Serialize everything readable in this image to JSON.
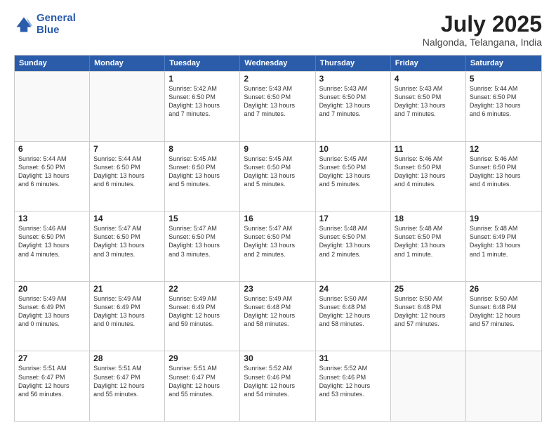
{
  "logo": {
    "text_general": "General",
    "text_blue": "Blue"
  },
  "title": "July 2025",
  "location": "Nalgonda, Telangana, India",
  "weekdays": [
    "Sunday",
    "Monday",
    "Tuesday",
    "Wednesday",
    "Thursday",
    "Friday",
    "Saturday"
  ],
  "rows": [
    [
      {
        "day": "",
        "lines": []
      },
      {
        "day": "",
        "lines": []
      },
      {
        "day": "1",
        "lines": [
          "Sunrise: 5:42 AM",
          "Sunset: 6:50 PM",
          "Daylight: 13 hours",
          "and 7 minutes."
        ]
      },
      {
        "day": "2",
        "lines": [
          "Sunrise: 5:43 AM",
          "Sunset: 6:50 PM",
          "Daylight: 13 hours",
          "and 7 minutes."
        ]
      },
      {
        "day": "3",
        "lines": [
          "Sunrise: 5:43 AM",
          "Sunset: 6:50 PM",
          "Daylight: 13 hours",
          "and 7 minutes."
        ]
      },
      {
        "day": "4",
        "lines": [
          "Sunrise: 5:43 AM",
          "Sunset: 6:50 PM",
          "Daylight: 13 hours",
          "and 7 minutes."
        ]
      },
      {
        "day": "5",
        "lines": [
          "Sunrise: 5:44 AM",
          "Sunset: 6:50 PM",
          "Daylight: 13 hours",
          "and 6 minutes."
        ]
      }
    ],
    [
      {
        "day": "6",
        "lines": [
          "Sunrise: 5:44 AM",
          "Sunset: 6:50 PM",
          "Daylight: 13 hours",
          "and 6 minutes."
        ]
      },
      {
        "day": "7",
        "lines": [
          "Sunrise: 5:44 AM",
          "Sunset: 6:50 PM",
          "Daylight: 13 hours",
          "and 6 minutes."
        ]
      },
      {
        "day": "8",
        "lines": [
          "Sunrise: 5:45 AM",
          "Sunset: 6:50 PM",
          "Daylight: 13 hours",
          "and 5 minutes."
        ]
      },
      {
        "day": "9",
        "lines": [
          "Sunrise: 5:45 AM",
          "Sunset: 6:50 PM",
          "Daylight: 13 hours",
          "and 5 minutes."
        ]
      },
      {
        "day": "10",
        "lines": [
          "Sunrise: 5:45 AM",
          "Sunset: 6:50 PM",
          "Daylight: 13 hours",
          "and 5 minutes."
        ]
      },
      {
        "day": "11",
        "lines": [
          "Sunrise: 5:46 AM",
          "Sunset: 6:50 PM",
          "Daylight: 13 hours",
          "and 4 minutes."
        ]
      },
      {
        "day": "12",
        "lines": [
          "Sunrise: 5:46 AM",
          "Sunset: 6:50 PM",
          "Daylight: 13 hours",
          "and 4 minutes."
        ]
      }
    ],
    [
      {
        "day": "13",
        "lines": [
          "Sunrise: 5:46 AM",
          "Sunset: 6:50 PM",
          "Daylight: 13 hours",
          "and 4 minutes."
        ]
      },
      {
        "day": "14",
        "lines": [
          "Sunrise: 5:47 AM",
          "Sunset: 6:50 PM",
          "Daylight: 13 hours",
          "and 3 minutes."
        ]
      },
      {
        "day": "15",
        "lines": [
          "Sunrise: 5:47 AM",
          "Sunset: 6:50 PM",
          "Daylight: 13 hours",
          "and 3 minutes."
        ]
      },
      {
        "day": "16",
        "lines": [
          "Sunrise: 5:47 AM",
          "Sunset: 6:50 PM",
          "Daylight: 13 hours",
          "and 2 minutes."
        ]
      },
      {
        "day": "17",
        "lines": [
          "Sunrise: 5:48 AM",
          "Sunset: 6:50 PM",
          "Daylight: 13 hours",
          "and 2 minutes."
        ]
      },
      {
        "day": "18",
        "lines": [
          "Sunrise: 5:48 AM",
          "Sunset: 6:50 PM",
          "Daylight: 13 hours",
          "and 1 minute."
        ]
      },
      {
        "day": "19",
        "lines": [
          "Sunrise: 5:48 AM",
          "Sunset: 6:49 PM",
          "Daylight: 13 hours",
          "and 1 minute."
        ]
      }
    ],
    [
      {
        "day": "20",
        "lines": [
          "Sunrise: 5:49 AM",
          "Sunset: 6:49 PM",
          "Daylight: 13 hours",
          "and 0 minutes."
        ]
      },
      {
        "day": "21",
        "lines": [
          "Sunrise: 5:49 AM",
          "Sunset: 6:49 PM",
          "Daylight: 13 hours",
          "and 0 minutes."
        ]
      },
      {
        "day": "22",
        "lines": [
          "Sunrise: 5:49 AM",
          "Sunset: 6:49 PM",
          "Daylight: 12 hours",
          "and 59 minutes."
        ]
      },
      {
        "day": "23",
        "lines": [
          "Sunrise: 5:49 AM",
          "Sunset: 6:48 PM",
          "Daylight: 12 hours",
          "and 58 minutes."
        ]
      },
      {
        "day": "24",
        "lines": [
          "Sunrise: 5:50 AM",
          "Sunset: 6:48 PM",
          "Daylight: 12 hours",
          "and 58 minutes."
        ]
      },
      {
        "day": "25",
        "lines": [
          "Sunrise: 5:50 AM",
          "Sunset: 6:48 PM",
          "Daylight: 12 hours",
          "and 57 minutes."
        ]
      },
      {
        "day": "26",
        "lines": [
          "Sunrise: 5:50 AM",
          "Sunset: 6:48 PM",
          "Daylight: 12 hours",
          "and 57 minutes."
        ]
      }
    ],
    [
      {
        "day": "27",
        "lines": [
          "Sunrise: 5:51 AM",
          "Sunset: 6:47 PM",
          "Daylight: 12 hours",
          "and 56 minutes."
        ]
      },
      {
        "day": "28",
        "lines": [
          "Sunrise: 5:51 AM",
          "Sunset: 6:47 PM",
          "Daylight: 12 hours",
          "and 55 minutes."
        ]
      },
      {
        "day": "29",
        "lines": [
          "Sunrise: 5:51 AM",
          "Sunset: 6:47 PM",
          "Daylight: 12 hours",
          "and 55 minutes."
        ]
      },
      {
        "day": "30",
        "lines": [
          "Sunrise: 5:52 AM",
          "Sunset: 6:46 PM",
          "Daylight: 12 hours",
          "and 54 minutes."
        ]
      },
      {
        "day": "31",
        "lines": [
          "Sunrise: 5:52 AM",
          "Sunset: 6:46 PM",
          "Daylight: 12 hours",
          "and 53 minutes."
        ]
      },
      {
        "day": "",
        "lines": []
      },
      {
        "day": "",
        "lines": []
      }
    ]
  ]
}
